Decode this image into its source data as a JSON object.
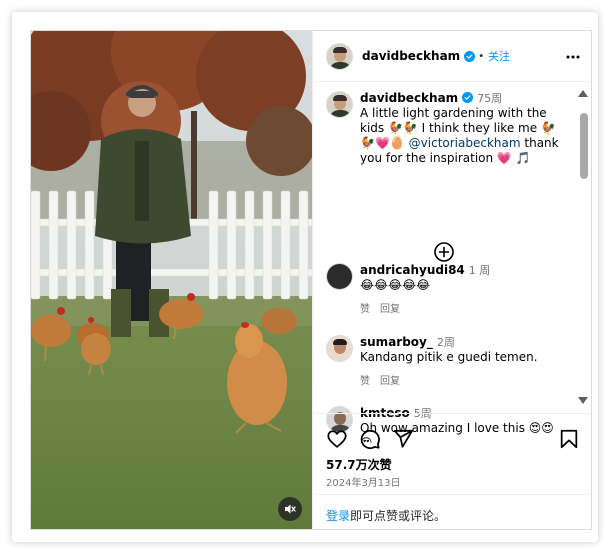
{
  "post": {
    "author": "davidbeckham",
    "follow_label": "关注",
    "dot": "•",
    "caption": {
      "username": "davidbeckham",
      "time": "75周",
      "text_part1": "A little light gardening with the kids 🐓🐓 I think they like me 🐓🐓💗🥚",
      "mention": "@victoriabeckham",
      "text_part2": "thank you for the inspiration 💗 🎵"
    },
    "comments": [
      {
        "username": "andricahyudi84",
        "time": "1 周",
        "text": "😂😂😂😂😂",
        "like_label": "赞",
        "reply_label": "回复"
      },
      {
        "username": "sumarboy_",
        "time": "2周",
        "text": "Kandang pitik e guedi temen.",
        "like_label": "赞",
        "reply_label": "回复"
      },
      {
        "username": "kmteso",
        "time": "5周",
        "text": "Oh wow amazing I love this 😍😍😍"
      }
    ],
    "likes": "57.7万次赞",
    "date": "2024年3月13日",
    "login_link": "登录",
    "login_rest": "即可点赞或评论。"
  },
  "icons": {
    "verified": "verified-badge-icon",
    "more": "more-options-icon",
    "add_comment": "plus-circle-icon",
    "like": "heart-icon",
    "comment": "comment-icon",
    "share": "share-icon",
    "save": "bookmark-icon",
    "mute": "speaker-muted-icon"
  },
  "colors": {
    "accent": "#0095f6",
    "mention": "#00376b",
    "secondary_text": "#737373"
  }
}
